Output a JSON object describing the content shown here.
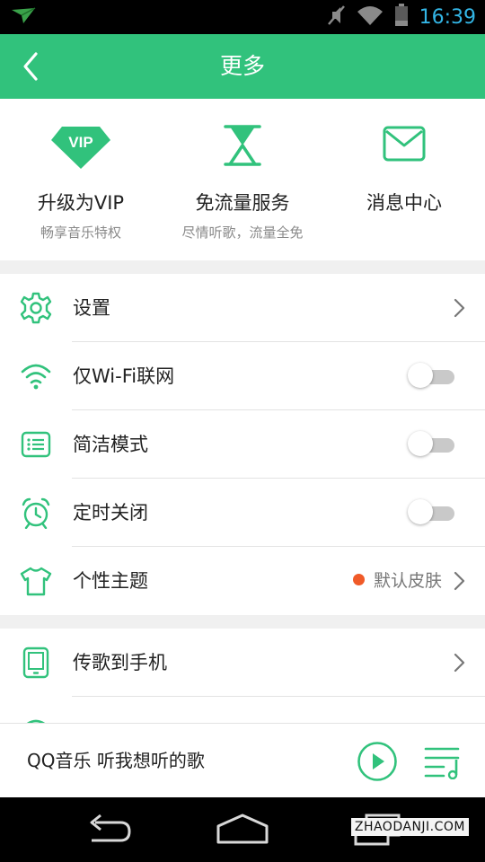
{
  "status_bar": {
    "time": "16:39",
    "icons": [
      "app-notification-icon",
      "mute-icon",
      "wifi-icon",
      "battery-icon"
    ]
  },
  "app_bar": {
    "title": "更多",
    "back_icon": "back-arrow-icon"
  },
  "quick_actions": [
    {
      "title": "升级为VIP",
      "subtitle": "畅享音乐特权",
      "icon": "vip-diamond-icon",
      "icon_text": "VIP"
    },
    {
      "title": "免流量服务",
      "subtitle": "尽情听歌，流量全免",
      "icon": "hourglass-icon"
    },
    {
      "title": "消息中心",
      "subtitle": "",
      "icon": "envelope-icon"
    }
  ],
  "settings": {
    "items": [
      {
        "label": "设置",
        "icon": "gear-icon",
        "control": "chevron"
      },
      {
        "label": "仅Wi-Fi联网",
        "icon": "wifi-icon",
        "control": "toggle",
        "on": false
      },
      {
        "label": "简洁模式",
        "icon": "list-icon",
        "control": "toggle",
        "on": false
      },
      {
        "label": "定时关闭",
        "icon": "alarm-clock-icon",
        "control": "toggle",
        "on": false
      },
      {
        "label": "个性主题",
        "icon": "tshirt-icon",
        "control": "chevron",
        "value": "默认皮肤"
      }
    ]
  },
  "more_list": {
    "items": [
      {
        "label": "传歌到手机",
        "icon": "phone-icon",
        "control": "chevron"
      }
    ]
  },
  "player": {
    "text": "QQ音乐 听我想听的歌",
    "play_icon": "play-icon",
    "playlist_icon": "playlist-icon"
  },
  "nav_bar": {
    "icons": [
      "back-icon",
      "home-icon",
      "recent-apps-icon"
    ]
  },
  "watermark": "ZHAODANJI.COM",
  "colors": {
    "accent": "#31c27c",
    "skin_dot": "#f05a28",
    "status_text": "#33b5e5"
  }
}
